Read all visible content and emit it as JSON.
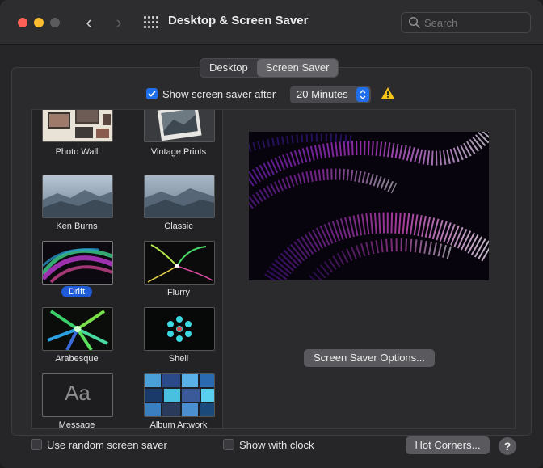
{
  "window": {
    "title": "Desktop & Screen Saver",
    "back_glyph": "‹",
    "forward_glyph": "›"
  },
  "search": {
    "placeholder": "Search"
  },
  "tabs": [
    {
      "label": "Desktop",
      "active": false
    },
    {
      "label": "Screen Saver",
      "active": true
    }
  ],
  "show_after": {
    "label": "Show screen saver after",
    "checked": true,
    "value": "20 Minutes"
  },
  "savers": [
    {
      "label": "Photo Wall"
    },
    {
      "label": "Vintage Prints"
    },
    {
      "label": "Ken Burns"
    },
    {
      "label": "Classic"
    },
    {
      "label": "Drift",
      "selected": true
    },
    {
      "label": "Flurry"
    },
    {
      "label": "Arabesque"
    },
    {
      "label": "Shell"
    },
    {
      "label": "Message",
      "glyph": "Aa"
    },
    {
      "label": "Album Artwork"
    }
  ],
  "options_button": "Screen Saver Options...",
  "footer": {
    "random_label": "Use random screen saver",
    "clock_label": "Show with clock",
    "hot_corners": "Hot Corners...",
    "help": "?"
  },
  "colors": {
    "accent": "#1f6feb",
    "warning": "#f5c518"
  }
}
